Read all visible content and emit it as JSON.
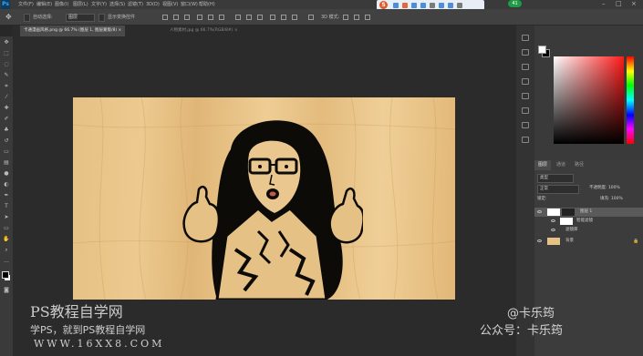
{
  "app": {
    "logo": "Ps"
  },
  "menu": [
    "文件(F)",
    "编辑(E)",
    "图像(I)",
    "图层(L)",
    "文字(Y)",
    "选择(S)",
    "滤镜(T)",
    "3D(D)",
    "视图(V)",
    "窗口(W)",
    "帮助(H)"
  ],
  "options": {
    "auto_select_label": "自动选择:",
    "auto_select_value": "图层",
    "transform_label": "显示变换控件"
  },
  "overlay": {
    "logo_letter": "S",
    "avatar": "41"
  },
  "tabs": [
    {
      "label": "卡通漫画风格.png @ 66.7% (图层 1, 图层蒙版/8) ×",
      "active": true
    },
    {
      "label": "人物素材.jpg @ 66.7%(RGB/8#) ×",
      "active": false
    }
  ],
  "panels": {
    "layers_tabs": [
      "图层",
      "通道",
      "路径"
    ],
    "filter_kind": "类型",
    "blend_mode": "正常",
    "opacity": "不透明度: 100%",
    "lock_label": "锁定:",
    "fill": "填充: 100%",
    "layers": [
      {
        "name": "图层 1",
        "selected": true
      },
      {
        "name": "智能滤镜",
        "selected": false
      },
      {
        "name": "滤镜库",
        "selected": false
      },
      {
        "name": "背景",
        "selected": false
      }
    ]
  },
  "watermark": {
    "site_title": "PS教程自学网",
    "site_slogan": "学PS，就到PS教程自学网",
    "site_url": "WWW.16XX8.COM",
    "author_handle": "@卡乐筠",
    "author_account": "公众号：卡乐筠"
  },
  "colors": {
    "accent_blue": "#31a8ff",
    "panel_bg": "#3a3a3a",
    "canvas_bg": "#2b2b2b",
    "wood": "#e6c185"
  }
}
